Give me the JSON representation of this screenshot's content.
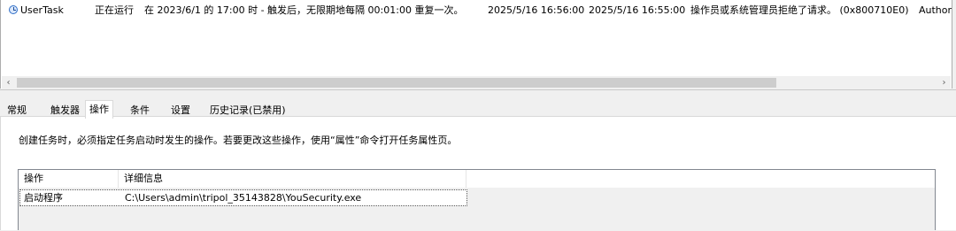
{
  "task_list": {
    "row": {
      "icon": "clock-icon",
      "name": "UserTask",
      "status": "正在运行",
      "trigger": "在 2023/6/1 的 17:00 时 - 触发后，无限期地每隔 00:01:00 重复一次。",
      "next_run": "2025/5/16 16:56:00",
      "last_run": "2025/5/16 16:55:00",
      "last_result": "操作员或系统管理员拒绝了请求。 (0x800710E0)",
      "author": "Author"
    }
  },
  "scrollbar": {
    "left_arrow": "‹",
    "right_arrow": "›"
  },
  "tabs": [
    {
      "label": "常规"
    },
    {
      "label": "触发器"
    },
    {
      "label": "操作"
    },
    {
      "label": "条件"
    },
    {
      "label": "设置"
    },
    {
      "label": "历史记录(已禁用)"
    }
  ],
  "actions_panel": {
    "description": "创建任务时，必须指定任务启动时发生的操作。若要更改这些操作，使用“属性”命令打开任务属性页。",
    "columns": [
      "操作",
      "详细信息"
    ],
    "rows": [
      {
        "action": "启动程序",
        "details": "C:\\Users\\admin\\tripol_35143828\\YouSecurity.exe"
      }
    ]
  }
}
